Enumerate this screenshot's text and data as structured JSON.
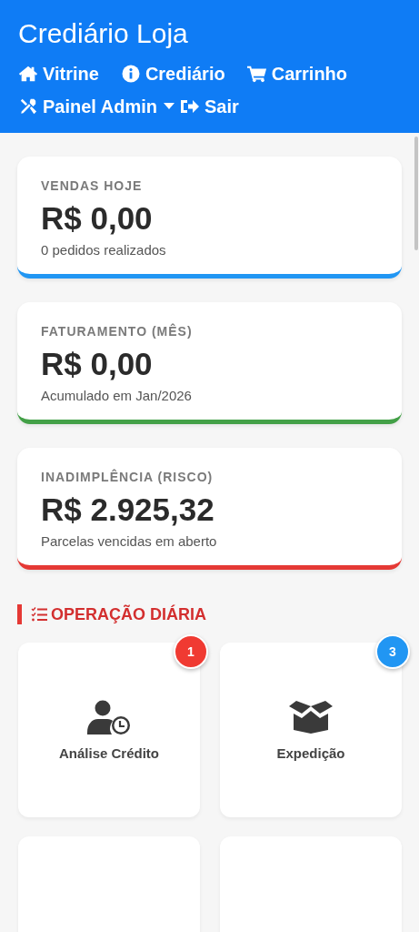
{
  "header": {
    "title": "Crediário Loja",
    "nav": [
      {
        "kind": "home",
        "label": "Vitrine"
      },
      {
        "kind": "info",
        "label": "Crediário"
      },
      {
        "kind": "cart",
        "label": "Carrinho"
      },
      {
        "kind": "tools",
        "label": "Painel Admin",
        "dropdown": true
      },
      {
        "kind": "exit",
        "label": "Sair"
      }
    ]
  },
  "stats": [
    {
      "label": "VENDAS HOJE",
      "value": "R$ 0,00",
      "note": "0 pedidos realizados",
      "color": "#2196f3"
    },
    {
      "label": "FATURAMENTO (MÊS)",
      "value": "R$ 0,00",
      "note": "Acumulado em Jan/2026",
      "color": "#43a047"
    },
    {
      "label": "INADIMPLÊNCIA (RISCO)",
      "value": "R$ 2.925,32",
      "note": "Parcelas vencidas em aberto",
      "color": "#e53935"
    }
  ],
  "section": {
    "title": "OPERAÇÃO DIÁRIA"
  },
  "tiles": [
    {
      "kind": "user-clock",
      "label": "Análise Crédito",
      "badge": "1",
      "color": "#f03a32"
    },
    {
      "kind": "box",
      "label": "Expedição",
      "badge": "3",
      "color": "#2196f3"
    },
    {
      "kind": "blank"
    },
    {
      "kind": "blank"
    }
  ]
}
